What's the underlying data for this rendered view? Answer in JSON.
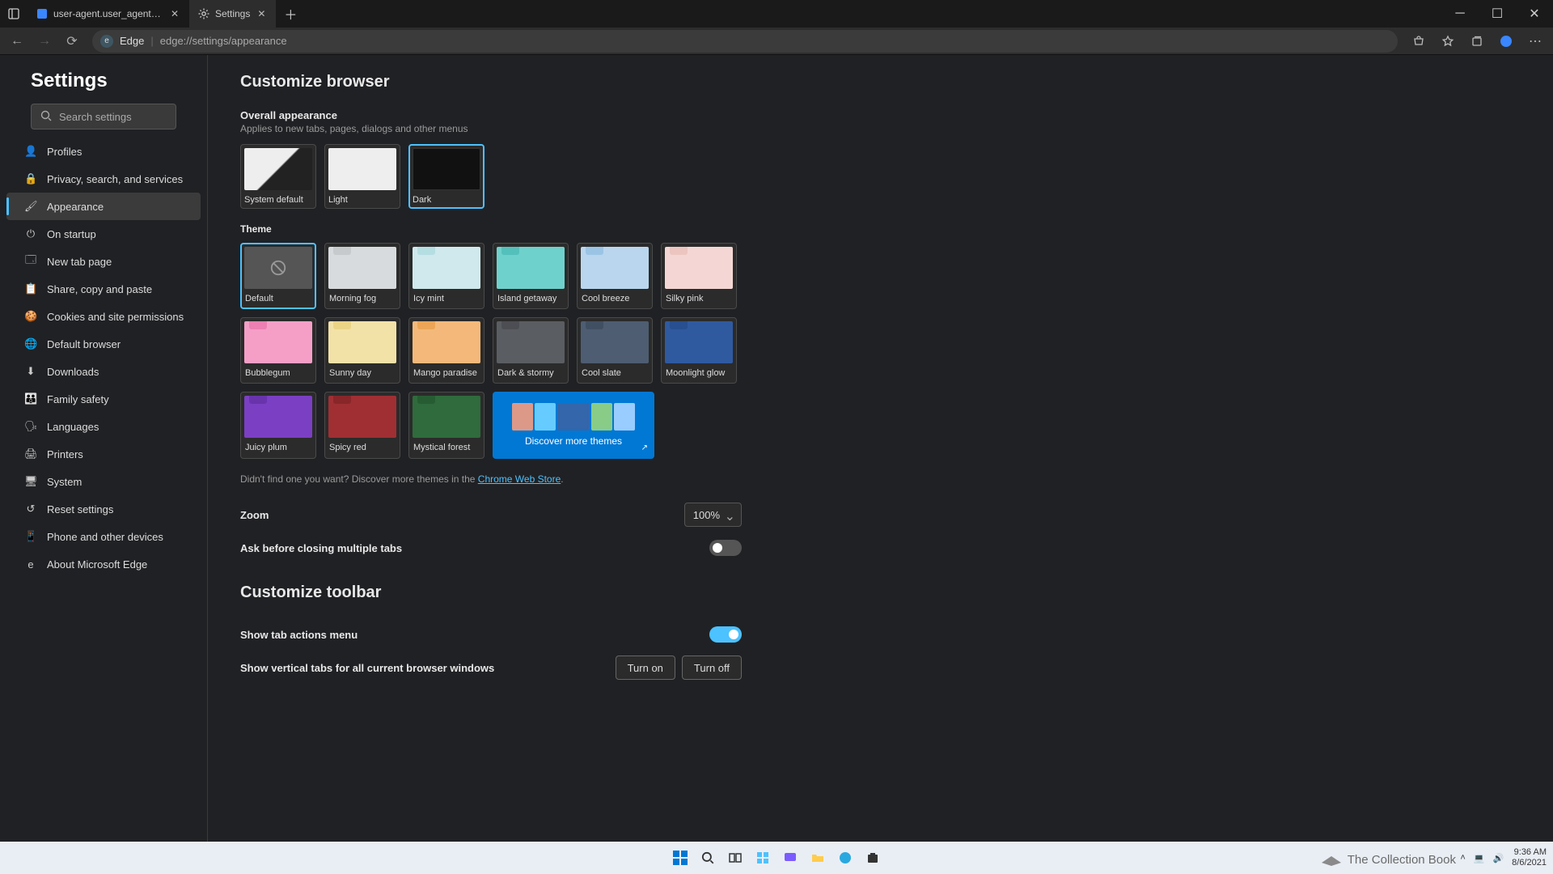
{
  "titlebar": {
    "tabs": [
      {
        "label": "user-agent.user_agent - The Col"
      },
      {
        "label": "Settings"
      }
    ]
  },
  "toolbar": {
    "site_label": "Edge",
    "url": "edge://settings/appearance"
  },
  "sidebar": {
    "title": "Settings",
    "search_placeholder": "Search settings",
    "items": [
      {
        "label": "Profiles"
      },
      {
        "label": "Privacy, search, and services"
      },
      {
        "label": "Appearance"
      },
      {
        "label": "On startup"
      },
      {
        "label": "New tab page"
      },
      {
        "label": "Share, copy and paste"
      },
      {
        "label": "Cookies and site permissions"
      },
      {
        "label": "Default browser"
      },
      {
        "label": "Downloads"
      },
      {
        "label": "Family safety"
      },
      {
        "label": "Languages"
      },
      {
        "label": "Printers"
      },
      {
        "label": "System"
      },
      {
        "label": "Reset settings"
      },
      {
        "label": "Phone and other devices"
      },
      {
        "label": "About Microsoft Edge"
      }
    ]
  },
  "content": {
    "heading1": "Customize browser",
    "overall": {
      "title": "Overall appearance",
      "sub": "Applies to new tabs, pages, dialogs and other menus",
      "options": [
        {
          "label": "System default"
        },
        {
          "label": "Light"
        },
        {
          "label": "Dark"
        }
      ],
      "selected": 2
    },
    "theme": {
      "title": "Theme",
      "options": [
        {
          "label": "Default",
          "color": "#555",
          "tab": "#777",
          "disabled": true
        },
        {
          "label": "Morning fog",
          "color": "#d8dbdd",
          "tab": "#bfc3c6"
        },
        {
          "label": "Icy mint",
          "color": "#cfe9ec",
          "tab": "#a9d8de"
        },
        {
          "label": "Island getaway",
          "color": "#6fd1cc",
          "tab": "#49b9b3"
        },
        {
          "label": "Cool breeze",
          "color": "#b9d6ee",
          "tab": "#8fbce0"
        },
        {
          "label": "Silky pink",
          "color": "#f4d7d4",
          "tab": "#e8bdb8"
        },
        {
          "label": "Bubblegum",
          "color": "#f59fc7",
          "tab": "#e874aa"
        },
        {
          "label": "Sunny day",
          "color": "#f3e2a7",
          "tab": "#e7cf76"
        },
        {
          "label": "Mango paradise",
          "color": "#f4b97a",
          "tab": "#e89c48"
        },
        {
          "label": "Dark & stormy",
          "color": "#5a5d61",
          "tab": "#46494d"
        },
        {
          "label": "Cool slate",
          "color": "#4e5d71",
          "tab": "#3c4a5c"
        },
        {
          "label": "Moonlight glow",
          "color": "#2f5aa0",
          "tab": "#254a87"
        },
        {
          "label": "Juicy plum",
          "color": "#7b3fc4",
          "tab": "#622fa3"
        },
        {
          "label": "Spicy red",
          "color": "#a02f33",
          "tab": "#7d2225"
        },
        {
          "label": "Mystical forest",
          "color": "#2f6b3c",
          "tab": "#24552f"
        }
      ],
      "discover_label": "Discover more themes",
      "selected": 0,
      "note_prefix": "Didn't find one you want? Discover more themes in the ",
      "note_link": "Chrome Web Store"
    },
    "zoom": {
      "label": "Zoom",
      "value": "100%"
    },
    "ask_close": {
      "label": "Ask before closing multiple tabs",
      "on": false
    },
    "heading2": "Customize toolbar",
    "show_tab_actions": {
      "label": "Show tab actions menu",
      "on": true
    },
    "vertical_tabs": {
      "label": "Show vertical tabs for all current browser windows",
      "turn_on": "Turn on",
      "turn_off": "Turn off"
    }
  },
  "systray": {
    "time": "9:36 AM",
    "date": "8/6/2021"
  },
  "watermark": "The Collection Book"
}
